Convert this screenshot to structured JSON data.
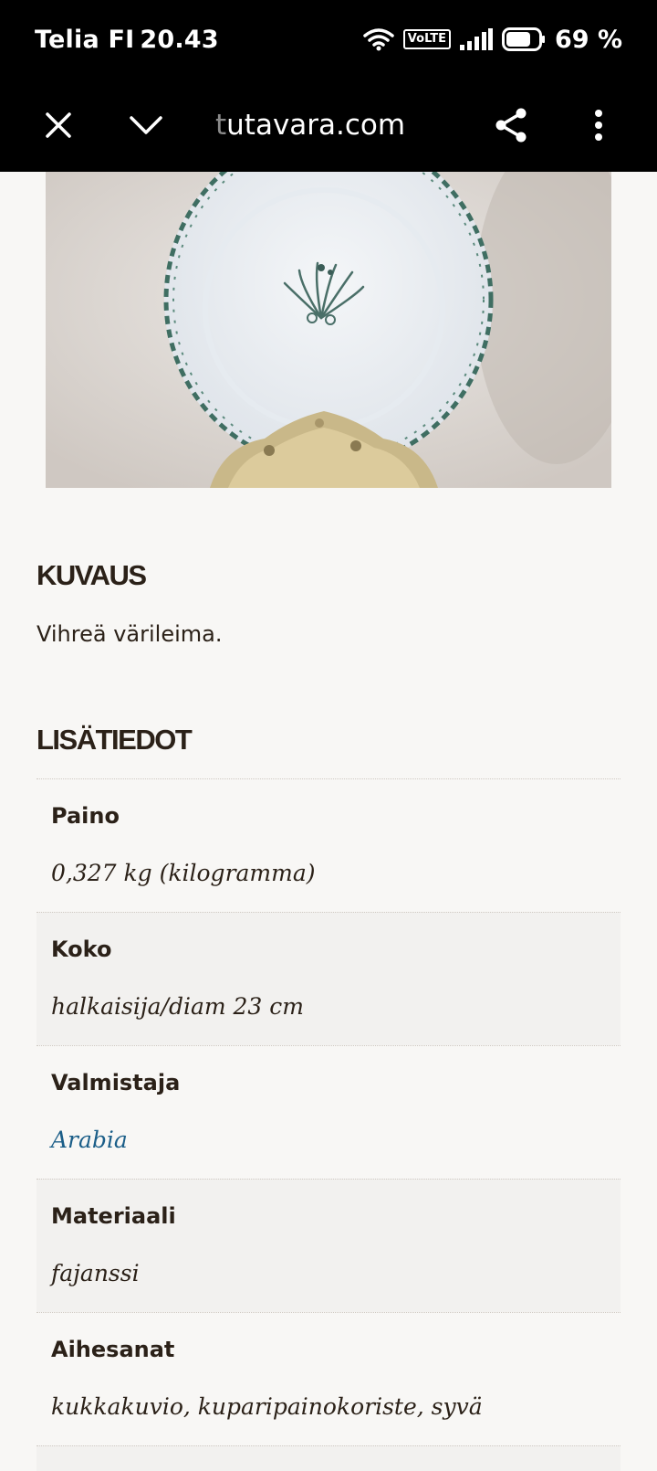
{
  "status_bar": {
    "carrier": "Telia FI",
    "time": "20.43",
    "volte": "VoLTE",
    "battery": "69 %"
  },
  "browser": {
    "url_dim": "t",
    "url_rest": "utavara.com",
    "icons": [
      "close-icon",
      "chevron-down-icon",
      "share-icon",
      "more-vert-icon"
    ]
  },
  "product": {
    "image": "plate-photo"
  },
  "description": {
    "title": "KUVAUS",
    "text": "Vihreä värileima."
  },
  "details": {
    "title": "LISÄTIEDOT",
    "rows": [
      {
        "label": "Paino",
        "value": "0,327 kg (kilogramma)"
      },
      {
        "label": "Koko",
        "value": "halkaisija/diam 23 cm"
      },
      {
        "label": "Valmistaja",
        "value": "Arabia"
      },
      {
        "label": "Materiaali",
        "value": "fajanssi"
      },
      {
        "label": "Aihesanat",
        "value": "kukkakuvio, kuparipainokoriste, syvä"
      }
    ]
  },
  "colors": {
    "link": "#1b5e88",
    "text": "#2b2118",
    "background": "#f8f7f5",
    "alt_row": "#f2f1ef"
  }
}
